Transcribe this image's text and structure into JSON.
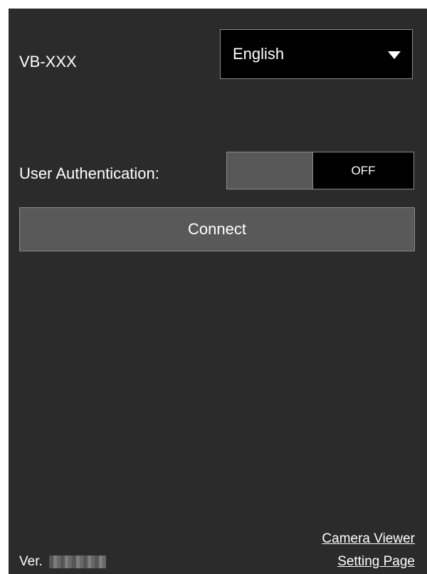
{
  "header": {
    "model_name": "VB-XXX",
    "language_select": {
      "selected": "English"
    }
  },
  "auth": {
    "label": "User Authentication:",
    "toggle_state": "OFF"
  },
  "actions": {
    "connect_label": "Connect"
  },
  "footer": {
    "version_prefix": "Ver.",
    "camera_viewer_link": "Camera Viewer",
    "setting_page_link": "Setting Page"
  },
  "colors": {
    "background": "#2b2b2b",
    "control_dark": "#000000",
    "control_gray": "#595959",
    "border": "#8a8a8a",
    "text": "#ffffff"
  },
  "icons": {
    "language_dropdown": "triangle-down-icon"
  }
}
